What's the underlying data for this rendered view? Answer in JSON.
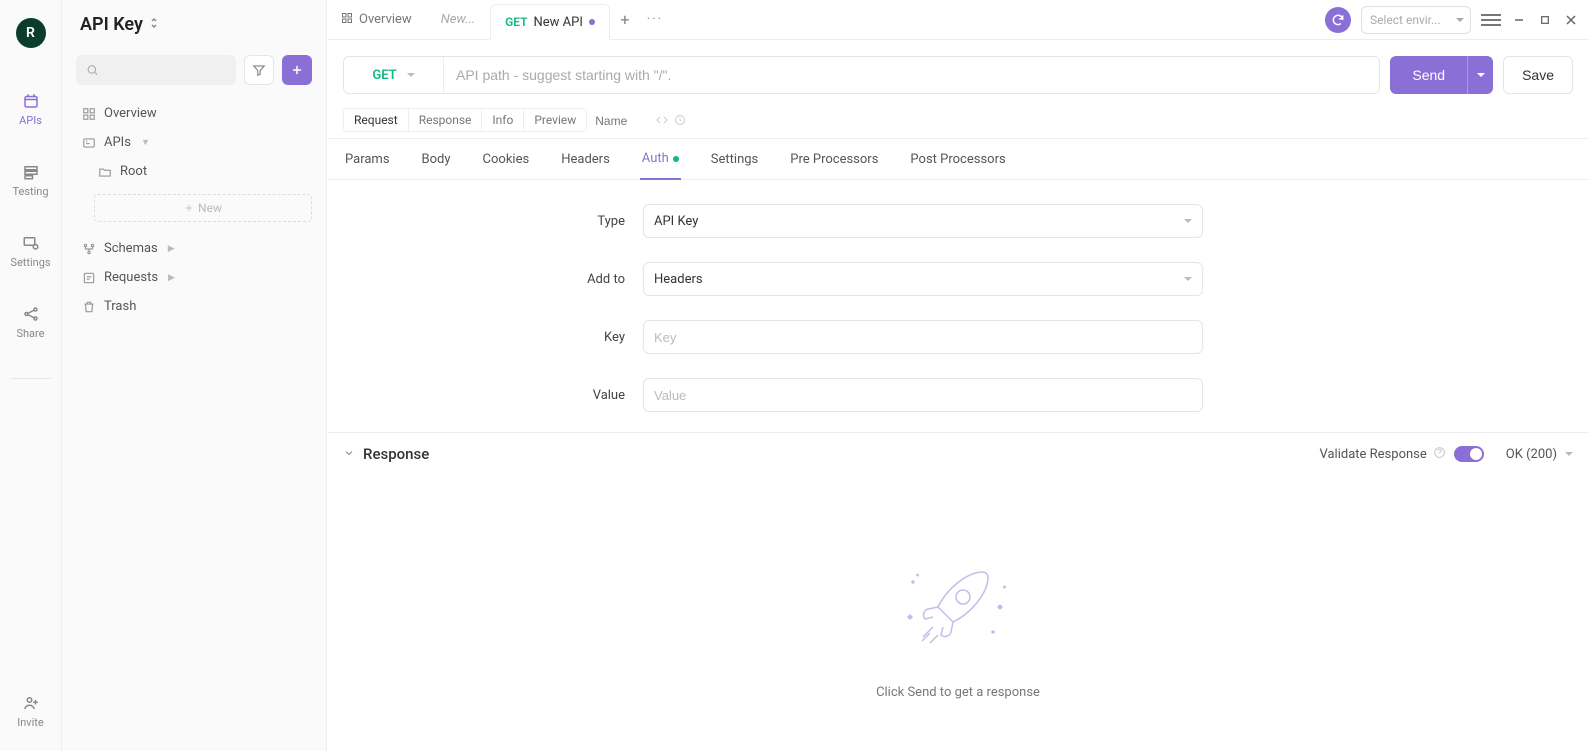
{
  "rail": {
    "avatar_initial": "R",
    "items": [
      {
        "label": "APIs"
      },
      {
        "label": "Testing"
      },
      {
        "label": "Settings"
      },
      {
        "label": "Share"
      }
    ],
    "invite": "Invite"
  },
  "sidebar": {
    "title": "API Key",
    "search_placeholder": "",
    "tree": {
      "overview": "Overview",
      "apis": "APIs",
      "root": "Root",
      "new_label": "New",
      "schemas": "Schemas",
      "requests": "Requests",
      "trash": "Trash"
    }
  },
  "topbar": {
    "tabs": [
      {
        "label": "Overview",
        "type": "overview"
      },
      {
        "label": "New...",
        "type": "italic"
      },
      {
        "method": "GET",
        "label": "New API",
        "type": "api",
        "active": true
      }
    ],
    "env_placeholder": "Select envir..."
  },
  "request": {
    "method": "GET",
    "path_placeholder": "API path - suggest starting with \"/\".",
    "send_label": "Send",
    "save_label": "Save"
  },
  "subtabs": {
    "pills": [
      "Request",
      "Response",
      "Info",
      "Preview"
    ],
    "active": "Request",
    "name_placeholder": "Name"
  },
  "innertabs": {
    "items": [
      "Params",
      "Body",
      "Cookies",
      "Headers",
      "Auth",
      "Settings",
      "Pre Processors",
      "Post Processors"
    ],
    "active": "Auth",
    "auth_badge": true
  },
  "auth_form": {
    "type_label": "Type",
    "type_value": "API Key",
    "addto_label": "Add to",
    "addto_value": "Headers",
    "key_label": "Key",
    "key_placeholder": "Key",
    "value_label": "Value",
    "value_placeholder": "Value"
  },
  "response": {
    "title": "Response",
    "validate_label": "Validate Response",
    "status_label": "OK (200)",
    "empty_message": "Click Send to get a response"
  }
}
